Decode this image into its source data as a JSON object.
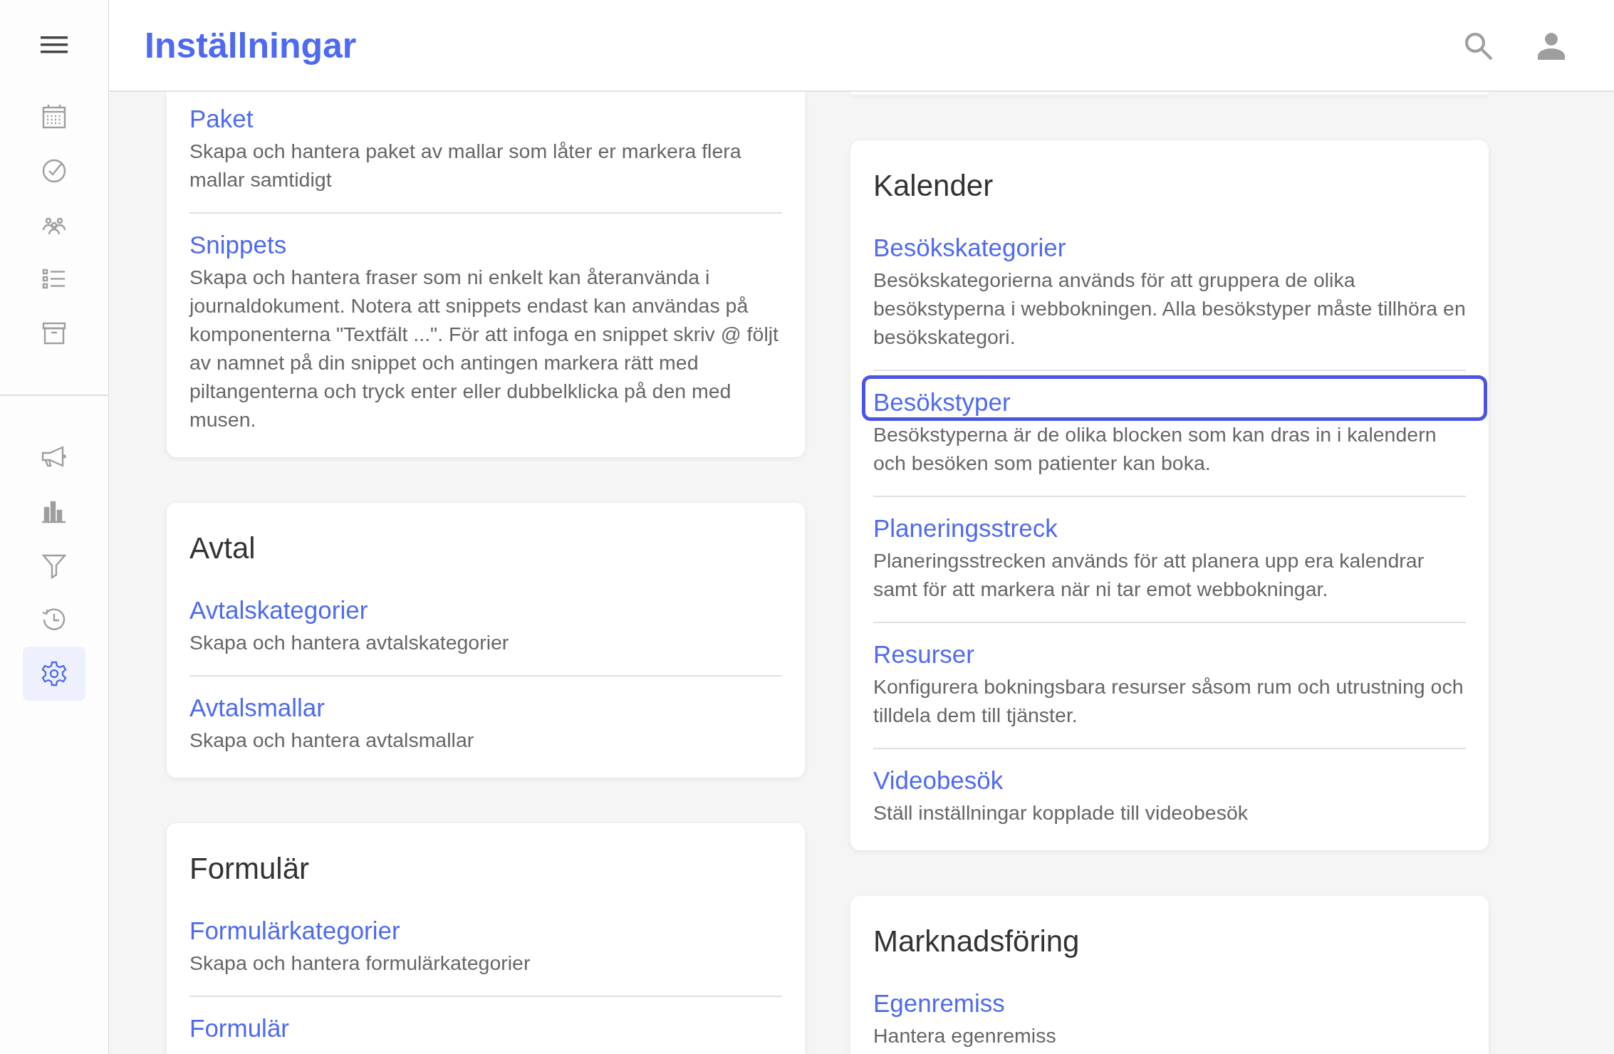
{
  "header": {
    "title": "Inställningar"
  },
  "sidebar": {
    "top_items": [
      {
        "selected": false
      },
      {
        "selected": false
      },
      {
        "selected": false
      },
      {
        "selected": false
      },
      {
        "selected": false
      }
    ],
    "bottom_items": [
      {
        "selected": false
      },
      {
        "selected": false
      },
      {
        "selected": false
      },
      {
        "selected": false
      },
      {
        "selected": true
      }
    ]
  },
  "columns": [
    {
      "cards": [
        {
          "kind": "cut",
          "items": [
            {
              "title": "Paket",
              "description": "Skapa och hantera paket av mallar som låter er markera flera mallar samtidigt",
              "highlighted": false
            },
            {
              "title": "Snippets",
              "description": "Skapa och hantera fraser som ni enkelt kan återanvända i journaldokument. Notera att snippets endast kan användas på komponenterna \"Textfält ...\". För att infoga en snippet skriv @ följt av namnet på din snippet och antingen markera rätt med piltangenterna och tryck enter eller dubbelklicka på den med musen.",
              "highlighted": false
            }
          ]
        },
        {
          "kind": "full",
          "heading": "Avtal",
          "items": [
            {
              "title": "Avtalskategorier",
              "description": "Skapa och hantera avtalskategorier",
              "highlighted": false
            },
            {
              "title": "Avtalsmallar",
              "description": "Skapa och hantera avtalsmallar",
              "highlighted": false
            }
          ]
        },
        {
          "kind": "full",
          "heading": "Formulär",
          "items": [
            {
              "title": "Formulärkategorier",
              "description": "Skapa och hantera formulärkategorier",
              "highlighted": false
            },
            {
              "title": "Formulär",
              "highlighted": false
            }
          ]
        }
      ]
    },
    {
      "cards": [
        {
          "kind": "fragment"
        },
        {
          "kind": "full",
          "heading": "Kalender",
          "items": [
            {
              "title": "Besökskategorier",
              "description": "Besökskategorierna används för att gruppera de olika besökstyperna i webbokningen. Alla besökstyper måste tillhöra en besökskategori.",
              "highlighted": false
            },
            {
              "title": "Besökstyper",
              "description": "Besökstyperna är de olika blocken som kan dras in i kalendern och besöken som patienter kan boka.",
              "highlighted": true
            },
            {
              "title": "Planeringsstreck",
              "description": "Planeringsstrecken används för att planera upp era kalendrar samt för att markera när ni tar emot webbokningar.",
              "highlighted": false
            },
            {
              "title": "Resurser",
              "description": "Konfigurera bokningsbara resurser såsom rum och utrustning och tilldela dem till tjänster.",
              "highlighted": false
            },
            {
              "title": "Videobesök",
              "description": "Ställ inställningar kopplade till videobesök",
              "highlighted": false
            }
          ]
        },
        {
          "kind": "full",
          "heading": "Marknadsföring",
          "items": [
            {
              "title": "Egenremiss",
              "description": "Hantera egenremiss",
              "highlighted": false
            }
          ]
        }
      ]
    }
  ]
}
